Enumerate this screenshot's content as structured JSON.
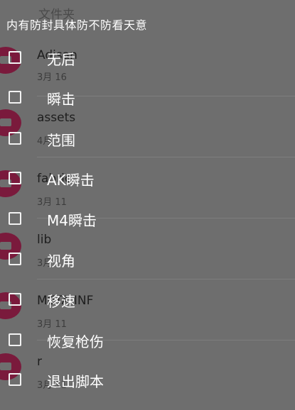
{
  "background": {
    "title": "文件夹",
    "rows": [
      {
        "name": "Adisan",
        "date": "3月 16"
      },
      {
        "name": "assets",
        "date": "4月"
      },
      {
        "name": "fabric",
        "date": "3月 11"
      },
      {
        "name": "lib",
        "date": "3月"
      },
      {
        "name": "META-INF",
        "date": "3月 11"
      },
      {
        "name": "r",
        "date": "3月 11"
      }
    ]
  },
  "overlay": {
    "title": "内有防封具体防不防看天意",
    "items": [
      {
        "label": "无后",
        "checked": false
      },
      {
        "label": "瞬击",
        "checked": false
      },
      {
        "label": "范围",
        "checked": false
      },
      {
        "label": "AK瞬击",
        "checked": false
      },
      {
        "label": "M4瞬击",
        "checked": false
      },
      {
        "label": "视角",
        "checked": false
      },
      {
        "label": "移速",
        "checked": false
      },
      {
        "label": "恢复枪伤",
        "checked": false
      },
      {
        "label": "退出脚本",
        "checked": false
      }
    ]
  },
  "colors": {
    "background": "#6e6e6e",
    "folder_accent": "#7a1a3c",
    "overlay_text": "#ffffff"
  }
}
